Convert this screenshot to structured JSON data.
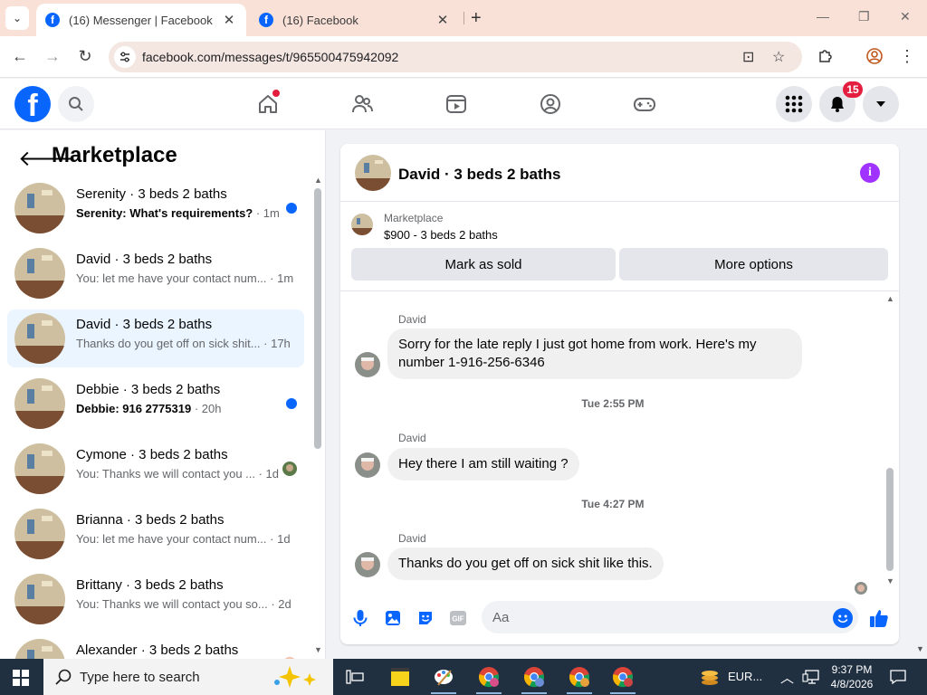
{
  "browser": {
    "tabs": [
      {
        "title": "(16) Messenger | Facebook",
        "close": "✕"
      },
      {
        "title": "(16) Facebook",
        "close": "✕"
      }
    ],
    "new_tab": "+",
    "url": "facebook.com/messages/t/965500475942092",
    "window_controls": {
      "minimize": "—",
      "restore": "❐",
      "close": "✕"
    }
  },
  "header": {
    "logo_letter": "f",
    "notifications_count": "15"
  },
  "sidebar": {
    "title": "Marketplace",
    "conversations": [
      {
        "name": "Serenity · 3 beds 2 baths",
        "snippet": "Serenity: What's requirements?",
        "time": " · 1m",
        "unread": true
      },
      {
        "name": "David · 3 beds 2 baths",
        "snippet": "You: let me have your contact num...",
        "time": " · 1m",
        "unread": false
      },
      {
        "name": "David · 3 beds 2 baths",
        "snippet": "Thanks do you get off on sick shit...",
        "time": " · 17h",
        "unread": false,
        "selected": true
      },
      {
        "name": "Debbie · 3 beds 2 baths",
        "snippet": "Debbie: 916 2775319",
        "time": " · 20h",
        "unread": true
      },
      {
        "name": "Cymone · 3 beds 2 baths",
        "snippet": "You: Thanks we will contact you ...",
        "time": " · 1d",
        "unread": false
      },
      {
        "name": "Brianna · 3 beds 2 baths",
        "snippet": "You: let me have your contact num...",
        "time": " · 1d",
        "unread": false
      },
      {
        "name": "Brittany · 3 beds 2 baths",
        "snippet": "You: Thanks we will contact you so...",
        "time": " · 2d",
        "unread": false
      },
      {
        "name": "Alexander · 3 beds 2 baths",
        "snippet": "",
        "time": "",
        "unread": false
      }
    ]
  },
  "chat": {
    "title": "David · 3 beds 2 baths",
    "listing": {
      "category": "Marketplace",
      "description": "$900 - 3 beds 2 baths",
      "mark_sold": "Mark as sold",
      "more_options": "More options"
    },
    "messages": [
      {
        "sender": "David",
        "text": "Sorry for the late reply I just got home from work.  Here's my number 1-916-256-6346"
      },
      {
        "timestamp": "Tue 2:55 PM"
      },
      {
        "sender": "David",
        "text": "Hey there I am still waiting ?"
      },
      {
        "timestamp": "Tue 4:27 PM"
      },
      {
        "sender": "David",
        "text": "Thanks do you get off on sick shit like this."
      }
    ],
    "composer_placeholder": "Aa"
  },
  "taskbar": {
    "search_label": "Type here to search",
    "tray_text": "EUR...",
    "time": "9:37 PM",
    "date": "4/8/2026"
  },
  "colors": {
    "fb_blue": "#0866ff",
    "badge_red": "#e41e3f",
    "selected_bg": "#ebf5ff",
    "info_purple": "#a033ff"
  }
}
